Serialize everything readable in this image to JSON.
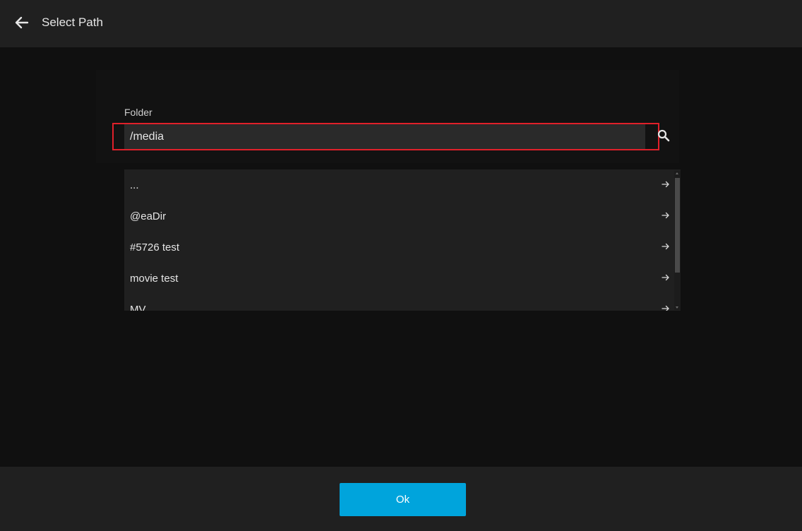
{
  "header": {
    "title": "Select Path",
    "back_icon": "arrow-left-icon"
  },
  "form": {
    "folder_label": "Folder",
    "folder_value": "/media",
    "search_icon": "search-icon",
    "highlight_color": "#e0202a"
  },
  "list": {
    "items": [
      {
        "label": "..."
      },
      {
        "label": "@eaDir"
      },
      {
        "label": "#5726 test"
      },
      {
        "label": "movie test"
      },
      {
        "label": "MV"
      }
    ],
    "item_icon": "arrow-right-icon"
  },
  "footer": {
    "ok_label": "Ok",
    "ok_color": "#00a4dc"
  }
}
